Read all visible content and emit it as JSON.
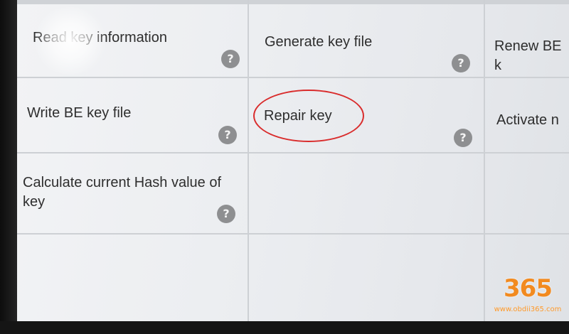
{
  "menu": {
    "items": [
      {
        "label": "Read key information"
      },
      {
        "label": "Generate key file"
      },
      {
        "label": "Renew BE k"
      },
      {
        "label": "Write BE key file"
      },
      {
        "label": "Repair key"
      },
      {
        "label": "Activate n"
      },
      {
        "label": "Calculate current Hash value of key"
      }
    ],
    "help_symbol": "?"
  },
  "highlight": {
    "target": "Repair key",
    "color": "#d92b2b"
  },
  "watermark": {
    "digits": "365",
    "url": "www.obdii365.com"
  },
  "colors": {
    "help_icon": "#8e8f91",
    "grid_line": "#cdd0d4",
    "text": "#2e2e2e"
  }
}
